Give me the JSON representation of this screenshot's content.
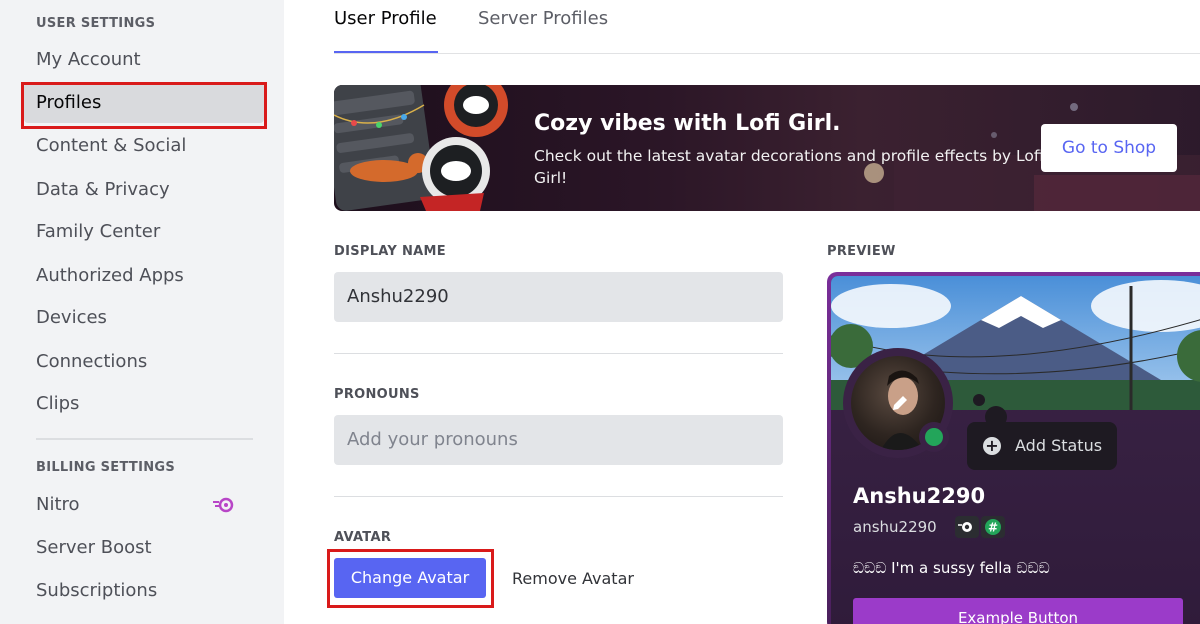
{
  "sidebar": {
    "user_settings_header": "USER SETTINGS",
    "user_items": [
      {
        "label": "My Account"
      },
      {
        "label": "Profiles"
      },
      {
        "label": "Content & Social"
      },
      {
        "label": "Data & Privacy"
      },
      {
        "label": "Family Center"
      },
      {
        "label": "Authorized Apps"
      },
      {
        "label": "Devices"
      },
      {
        "label": "Connections"
      },
      {
        "label": "Clips"
      }
    ],
    "selected_item": "Profiles",
    "billing_settings_header": "BILLING SETTINGS",
    "billing_items": [
      {
        "label": "Nitro",
        "icon": "nitro-icon"
      },
      {
        "label": "Server Boost"
      },
      {
        "label": "Subscriptions"
      }
    ]
  },
  "tabs": [
    {
      "label": "User Profile",
      "active": true
    },
    {
      "label": "Server Profiles",
      "active": false
    }
  ],
  "banner": {
    "title": "Cozy vibes with Lofi Girl.",
    "subtitle": "Check out the latest avatar decorations and profile effects by Lofi Girl!",
    "button_label": "Go to Shop"
  },
  "form": {
    "display_name_label": "DISPLAY NAME",
    "display_name_value": "Anshu2290",
    "pronouns_label": "PRONOUNS",
    "pronouns_placeholder": "Add your pronouns",
    "avatar_label": "AVATAR",
    "change_avatar_label": "Change Avatar",
    "remove_avatar_label": "Remove Avatar"
  },
  "preview": {
    "label": "PREVIEW",
    "display_name": "Anshu2290",
    "username": "anshu2290",
    "add_status_label": "Add Status",
    "bio": "ඞඞඞ I'm a sussy fella ඞඞඞ",
    "example_button_label": "Example Button",
    "status": "online"
  },
  "colors": {
    "accent": "#5865f2",
    "highlight_box": "#d91a1a",
    "online": "#23a55a",
    "profile_theme": "#7a2e9a",
    "example_button": "#9b3bc9"
  }
}
